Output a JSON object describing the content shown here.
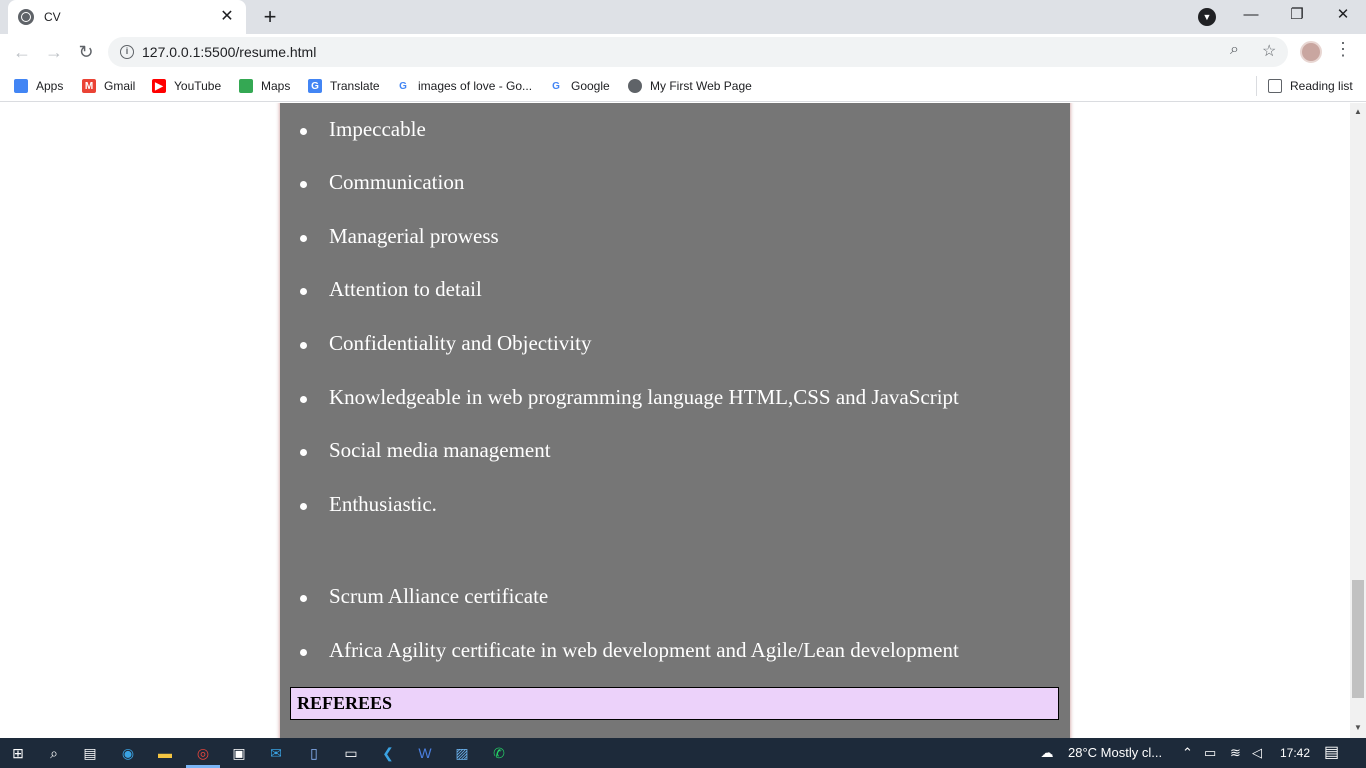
{
  "browser": {
    "tab_title": "CV",
    "tab_close": "✕",
    "new_tab": "+",
    "url": "127.0.0.1:5500/resume.html",
    "reading_list": "Reading list",
    "controls": {
      "minimize": "—",
      "restore": "❐",
      "close": "✕"
    }
  },
  "bookmarks": [
    {
      "label": "Apps",
      "icon": "apps-grid-icon",
      "color": "#4285f4"
    },
    {
      "label": "Gmail",
      "icon": "gmail-icon",
      "color": "#ea4335"
    },
    {
      "label": "YouTube",
      "icon": "youtube-icon",
      "color": "#ff0000"
    },
    {
      "label": "Maps",
      "icon": "maps-icon",
      "color": "#34a853"
    },
    {
      "label": "Translate",
      "icon": "translate-icon",
      "color": "#4285f4"
    },
    {
      "label": "images of love - Go...",
      "icon": "google-icon",
      "color": "#4285f4"
    },
    {
      "label": "Google",
      "icon": "google-icon",
      "color": "#4285f4"
    },
    {
      "label": "My First Web Page",
      "icon": "globe-icon",
      "color": "#5f6368"
    }
  ],
  "cv": {
    "skills": [
      "Impeccable",
      "Communication",
      "Managerial prowess",
      "Attention to detail",
      "Confidentiality and Objectivity",
      "Knowledgeable in web programming language HTML,CSS and JavaScript",
      "Social media management",
      "Enthusiastic."
    ],
    "certificates": [
      "Scrum Alliance certificate",
      "Africa Agility certificate in web development and Agile/Lean development"
    ],
    "referees_heading": "REFEREES",
    "panel_color": "#767676",
    "referees_bg": "#ecd2fa"
  },
  "taskbar": {
    "weather": "28°C  Mostly cl...",
    "time": "17:42"
  }
}
